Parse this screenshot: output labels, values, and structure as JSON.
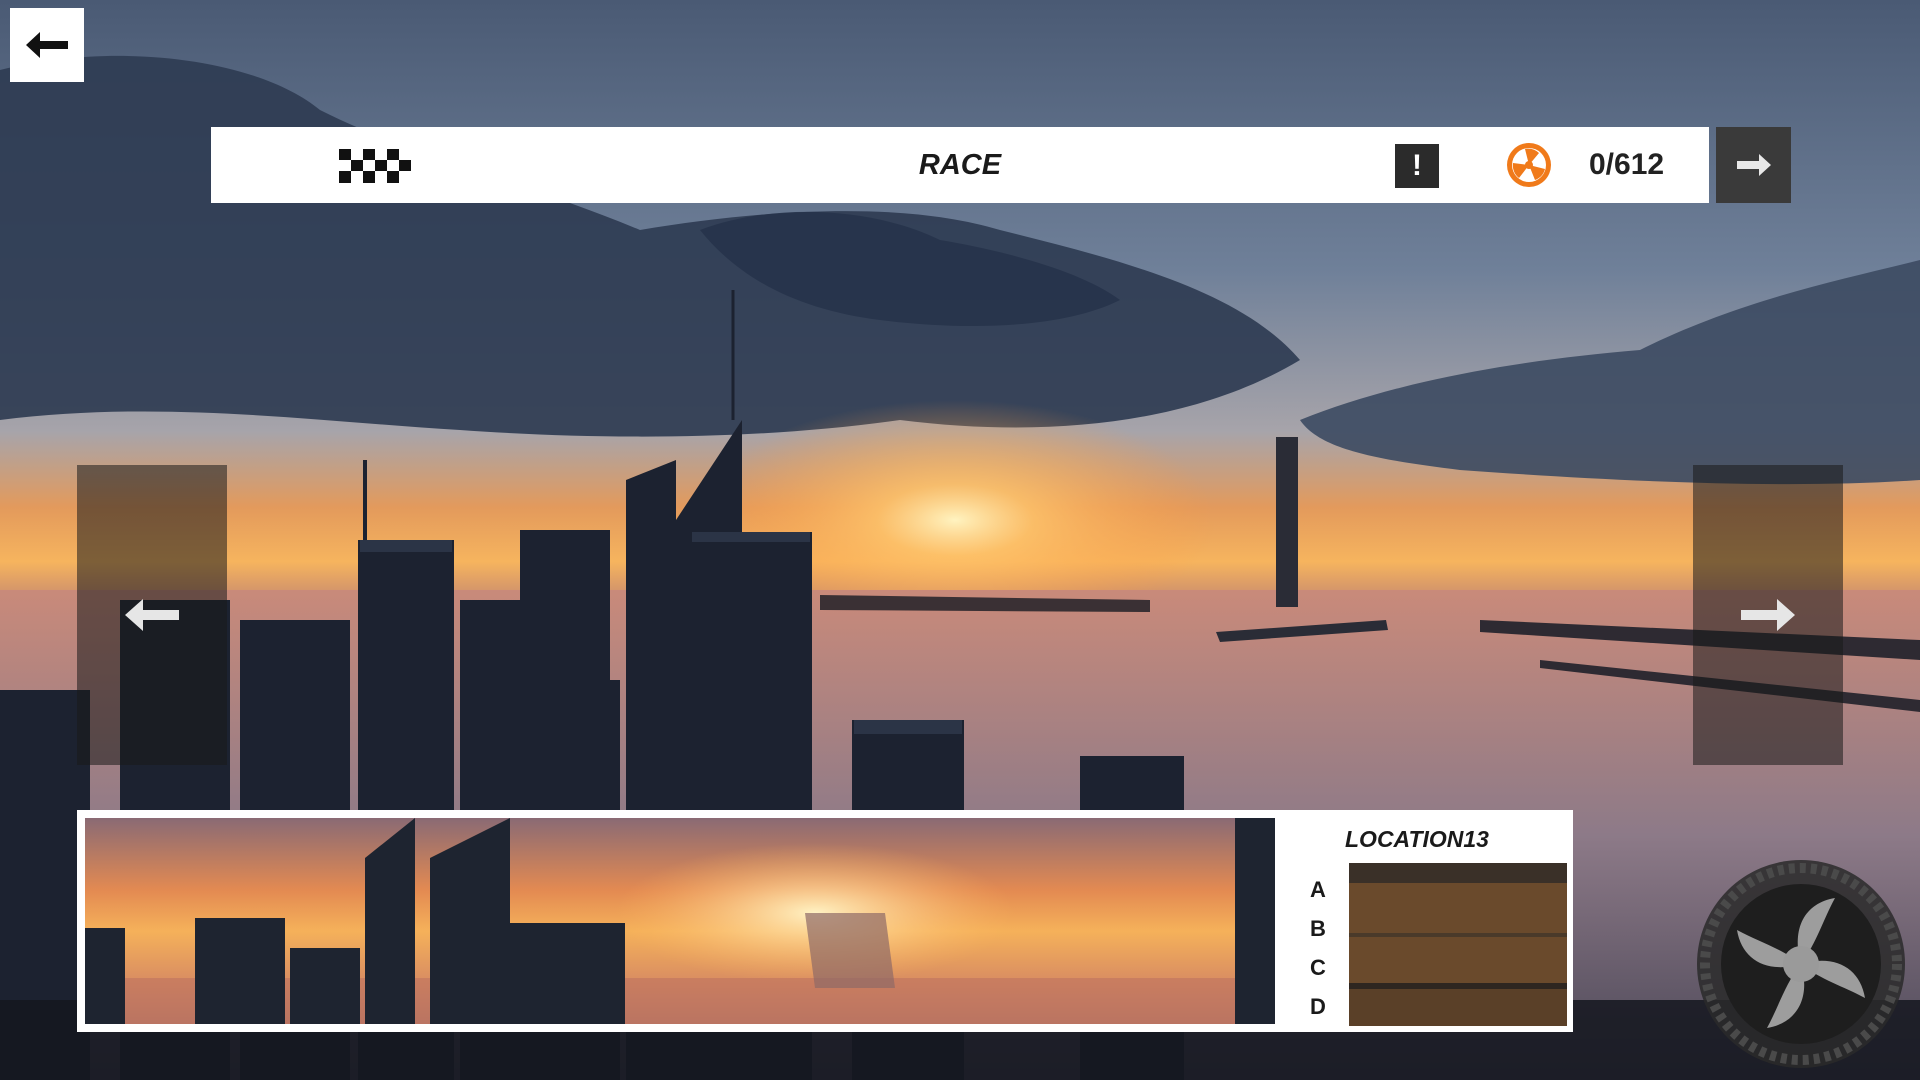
{
  "header": {
    "mode_title": "RACE",
    "alert_label": "!",
    "counter": "0/612"
  },
  "icons": {
    "back": "arrow-left-icon",
    "mode": "checkered-flag-icon",
    "alert": "exclamation-icon",
    "currency": "fan-icon",
    "next": "arrow-right-icon",
    "prev_location": "arrow-left-icon",
    "next_location": "arrow-right-icon",
    "wheel": "wheel-icon"
  },
  "location": {
    "name": "LOCATION13",
    "grades": [
      "A",
      "B",
      "C",
      "D"
    ]
  },
  "colors": {
    "accent": "#f07a1a",
    "panel": "#ffffff",
    "dark_button": "#3a3a3a"
  }
}
